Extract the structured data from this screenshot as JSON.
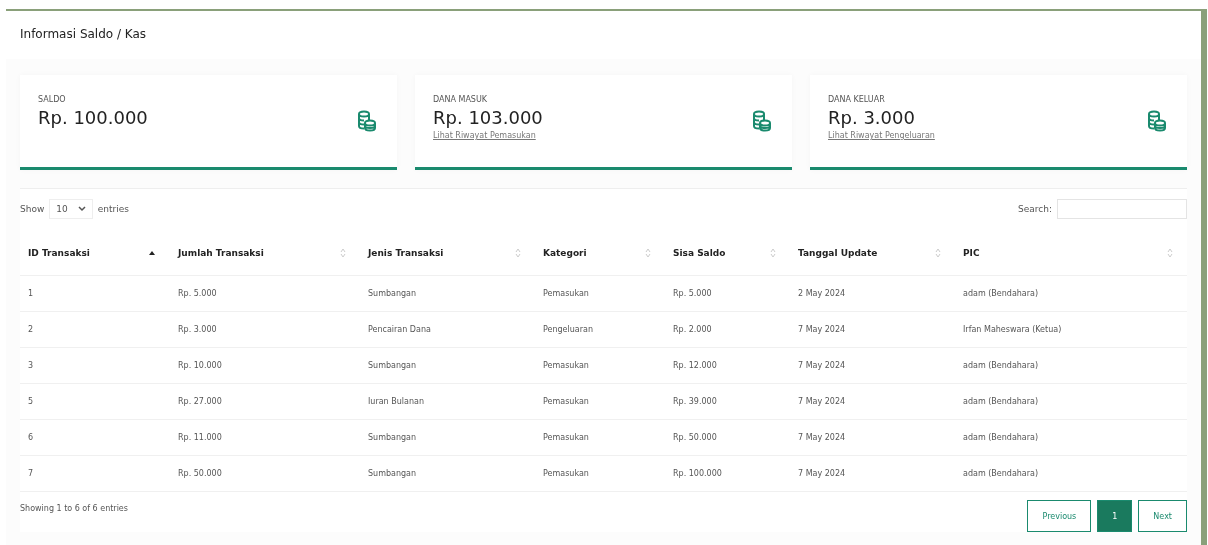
{
  "title": "Informasi Saldo / Kas",
  "cards": [
    {
      "label": "SALDO",
      "amount": "Rp. 100.000"
    },
    {
      "label": "DANA MASUK",
      "amount": "Rp. 103.000",
      "link": "Lihat Riwayat Pemasukan"
    },
    {
      "label": "DANA KELUAR",
      "amount": "Rp. 3.000",
      "link": "Lihat Riwayat Pengeluaran"
    }
  ],
  "length_control": {
    "before": "Show",
    "value": "10",
    "after": "entries"
  },
  "search": {
    "label": "Search:"
  },
  "table": {
    "columns": [
      {
        "label": "ID Transaksi",
        "sorted": true
      },
      {
        "label": "Jumlah Transaksi",
        "sorted": false
      },
      {
        "label": "Jenis Transaksi",
        "sorted": false
      },
      {
        "label": "Kategori",
        "sorted": false
      },
      {
        "label": "Sisa Saldo",
        "sorted": false
      },
      {
        "label": "Tanggal Update",
        "sorted": false
      },
      {
        "label": "PIC",
        "sorted": false
      }
    ],
    "rows": [
      [
        "1",
        "Rp. 5.000",
        "Sumbangan",
        "Pemasukan",
        "Rp. 5.000",
        "2 May 2024",
        "adam (Bendahara)"
      ],
      [
        "2",
        "Rp. 3.000",
        "Pencairan Dana",
        "Pengeluaran",
        "Rp. 2.000",
        "7 May 2024",
        "Irfan Maheswara (Ketua)"
      ],
      [
        "3",
        "Rp. 10.000",
        "Sumbangan",
        "Pemasukan",
        "Rp. 12.000",
        "7 May 2024",
        "adam (Bendahara)"
      ],
      [
        "5",
        "Rp. 27.000",
        "Iuran Bulanan",
        "Pemasukan",
        "Rp. 39.000",
        "7 May 2024",
        "adam (Bendahara)"
      ],
      [
        "6",
        "Rp. 11.000",
        "Sumbangan",
        "Pemasukan",
        "Rp. 50.000",
        "7 May 2024",
        "adam (Bendahara)"
      ],
      [
        "7",
        "Rp. 50.000",
        "Sumbangan",
        "Pemasukan",
        "Rp. 100.000",
        "7 May 2024",
        "adam (Bendahara)"
      ]
    ]
  },
  "info": "Showing 1 to 6 of 6 entries",
  "pagination": [
    {
      "label": "Previous",
      "selected": false
    },
    {
      "label": "1",
      "selected": true
    },
    {
      "label": "Next",
      "selected": false
    }
  ]
}
